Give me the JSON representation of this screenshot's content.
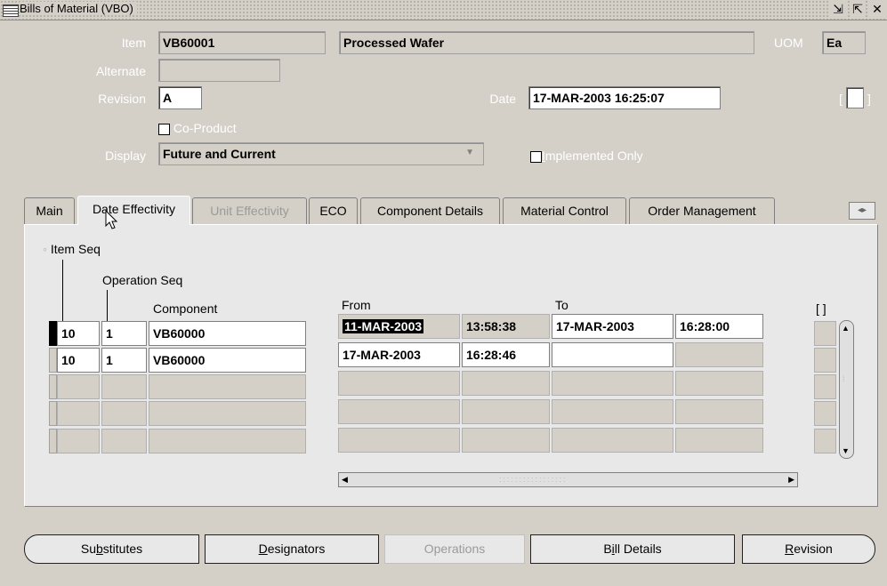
{
  "window": {
    "title": "Bills of Material (VBO)",
    "controls": [
      "⇲",
      "⇱",
      "✕"
    ]
  },
  "header": {
    "item_label": "Item",
    "item_value": "VB60001",
    "item_description": "Processed Wafer",
    "uom_label": "UOM",
    "uom_value": "Ea",
    "alternate_label": "Alternate",
    "alternate_value": "",
    "revision_label": "Revision",
    "revision_value": "A",
    "date_label": "Date",
    "date_value": "17-MAR-2003 16:25:07",
    "coproduct_label": "Co-Product",
    "coproduct_checked": true,
    "display_label": "Display",
    "display_value": "Future and Current",
    "implemented_label_pre": "",
    "implemented_label_u": "I",
    "implemented_label_post": "mplemented Only",
    "implemented_checked": true,
    "bracket_field": "[",
    "bracket_close": "]"
  },
  "tabs": [
    {
      "label": "Main",
      "state": "normal"
    },
    {
      "label": "Date Effectivity",
      "state": "active"
    },
    {
      "label": "Unit Effectivity",
      "state": "disabled"
    },
    {
      "label": "ECO",
      "state": "normal"
    },
    {
      "label": "Component Details",
      "state": "normal"
    },
    {
      "label": "Material Control",
      "state": "normal"
    },
    {
      "label": "Order Management",
      "state": "normal"
    }
  ],
  "table": {
    "item_seq_header": "Item Seq",
    "operation_seq_header": "Operation Seq",
    "component_header": "Component",
    "from_header": "From",
    "to_header": "To",
    "bracket_header": "[ ]",
    "rows": [
      {
        "item_seq": "10",
        "op_seq": "1",
        "component": "VB60000",
        "from_date": "11-MAR-2003",
        "from_time": "13:58:38",
        "to_date": "17-MAR-2003",
        "to_time": "16:28:00"
      },
      {
        "item_seq": "10",
        "op_seq": "1",
        "component": "VB60000",
        "from_date": "17-MAR-2003",
        "from_time": "16:28:46",
        "to_date": "",
        "to_time": ""
      },
      {
        "item_seq": "",
        "op_seq": "",
        "component": "",
        "from_date": "",
        "from_time": "",
        "to_date": "",
        "to_time": ""
      },
      {
        "item_seq": "",
        "op_seq": "",
        "component": "",
        "from_date": "",
        "from_time": "",
        "to_date": "",
        "to_time": ""
      },
      {
        "item_seq": "",
        "op_seq": "",
        "component": "",
        "from_date": "",
        "from_time": "",
        "to_date": "",
        "to_time": ""
      }
    ]
  },
  "buttons": {
    "substitutes_pre": "Su",
    "substitutes_u": "b",
    "substitutes_post": "stitutes",
    "designators_pre": "",
    "designators_u": "D",
    "designators_post": "esignators",
    "operations": "Operations",
    "bill_details_pre": "B",
    "bill_details_u": "i",
    "bill_details_post": "ll Details",
    "revision_pre": "",
    "revision_u": "R",
    "revision_post": "evision"
  }
}
